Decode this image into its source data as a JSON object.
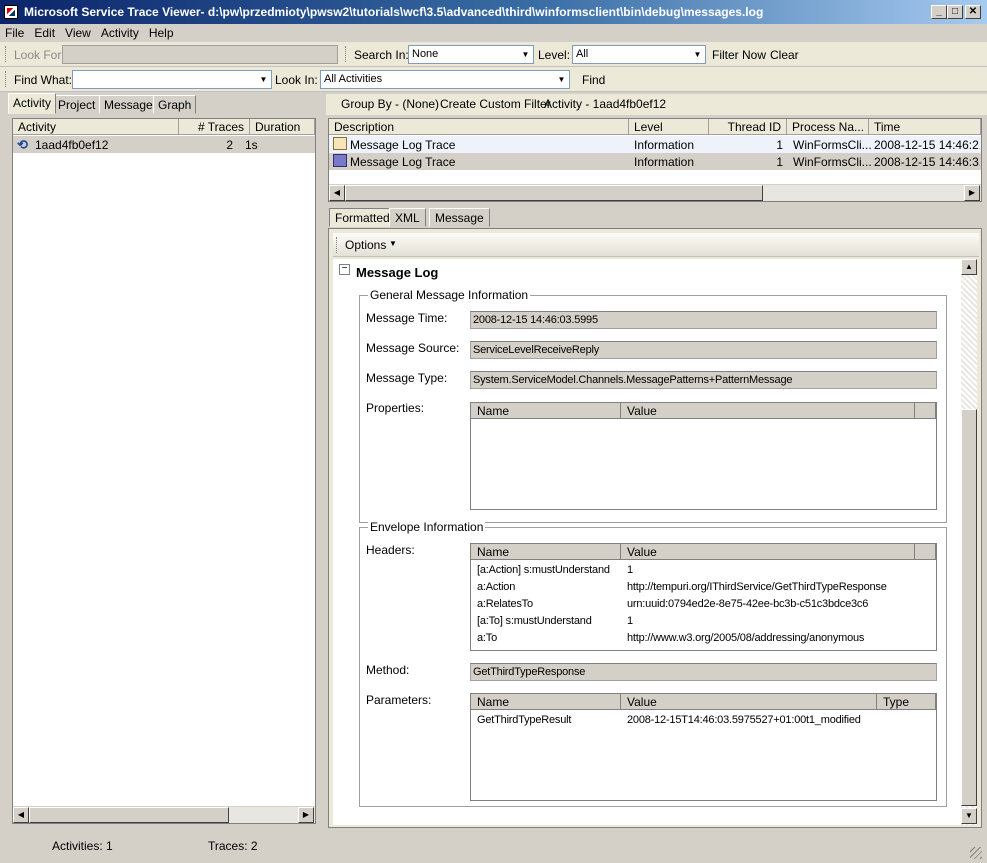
{
  "window": {
    "title": "Microsoft Service Trace Viewer- d:\\pw\\przedmioty\\pwsw2\\tutorials\\wcf\\3.5\\advanced\\third\\winformsclient\\bin\\debug\\messages.log",
    "minimize": "_",
    "maximize": "□",
    "close": "✕"
  },
  "menu": [
    "File",
    "Edit",
    "View",
    "Activity",
    "Help"
  ],
  "toolbar1": {
    "look_for_label": "Look For",
    "look_for_value": "",
    "search_in_label": "Search In:",
    "search_in_value": "None",
    "level_label": "Level:",
    "level_value": "All",
    "filter_now": "Filter Now",
    "clear": "Clear"
  },
  "toolbar2": {
    "find_what_label": "Find What:",
    "find_what_value": "",
    "look_in_label": "Look In:",
    "look_in_value": "All Activities",
    "find": "Find"
  },
  "left_tabs": [
    "Activity",
    "Project",
    "Message",
    "Graph"
  ],
  "activity_table": {
    "headers": [
      "Activity",
      "# Traces",
      "Duration"
    ],
    "rows": [
      {
        "name": "1aad4fb0ef12",
        "traces": "2",
        "duration": "1s"
      }
    ]
  },
  "right_toolbar": {
    "group_by": "Group By - (None)",
    "create_filter": "Create Custom Filter",
    "activity": "Activity - 1aad4fb0ef12"
  },
  "trace_table": {
    "headers": [
      "Description",
      "Level",
      "Thread ID",
      "Process Na...",
      "Time"
    ],
    "rows": [
      {
        "description": "Message Log Trace",
        "level": "Information",
        "thread": "1",
        "process": "WinFormsCli...",
        "time": "2008-12-15  14:46:2..."
      },
      {
        "description": "Message Log Trace",
        "level": "Information",
        "thread": "1",
        "process": "WinFormsCli...",
        "time": "2008-12-15  14:46:3..."
      }
    ]
  },
  "detail_tabs": [
    "Formatted",
    "XML",
    "Message"
  ],
  "options_label": "Options",
  "collapse_symbol": "−",
  "message_log": {
    "title": "Message Log",
    "general": {
      "title": "General Message Information",
      "time_label": "Message Time:",
      "time_value": "2008-12-15 14:46:03.5995",
      "source_label": "Message Source:",
      "source_value": "ServiceLevelReceiveReply",
      "type_label": "Message Type:",
      "type_value": "System.ServiceModel.Channels.MessagePatterns+PatternMessage",
      "properties_label": "Properties:",
      "properties_headers": [
        "Name",
        "Value"
      ]
    },
    "envelope": {
      "title": "Envelope Information",
      "headers_label": "Headers:",
      "headers_columns": [
        "Name",
        "Value"
      ],
      "headers_rows": [
        {
          "name": "[a:Action] s:mustUnderstand",
          "value": "1"
        },
        {
          "name": "a:Action",
          "value": "http://tempuri.org/IThirdService/GetThirdTypeResponse"
        },
        {
          "name": "a:RelatesTo",
          "value": "urn:uuid:0794ed2e-8e75-42ee-bc3b-c51c3bdce3c6"
        },
        {
          "name": "[a:To] s:mustUnderstand",
          "value": "1"
        },
        {
          "name": "a:To",
          "value": "http://www.w3.org/2005/08/addressing/anonymous"
        }
      ],
      "method_label": "Method:",
      "method_value": "GetThirdTypeResponse",
      "parameters_label": "Parameters:",
      "parameters_columns": [
        "Name",
        "Value",
        "Type"
      ],
      "parameters_rows": [
        {
          "name": "GetThirdTypeResult",
          "value": "2008-12-15T14:46:03.5975527+01:00t1_modified",
          "type": ""
        }
      ]
    }
  },
  "status": {
    "activities": "Activities: 1",
    "traces": "Traces: 2"
  }
}
